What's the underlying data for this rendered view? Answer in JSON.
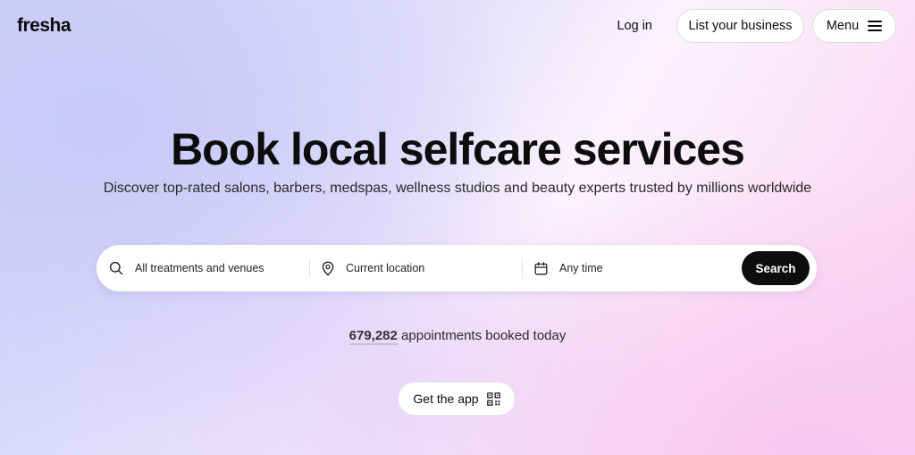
{
  "header": {
    "logo": "fresha",
    "login_label": "Log in",
    "list_business_label": "List your business",
    "menu_label": "Menu"
  },
  "hero": {
    "title": "Book local selfcare services",
    "subtitle": "Discover top-rated salons, barbers, medspas, wellness studios and beauty experts trusted by millions worldwide"
  },
  "search": {
    "treatments_placeholder": "All treatments and venues",
    "location_placeholder": "Current location",
    "time_placeholder": "Any time",
    "button_label": "Search"
  },
  "stats": {
    "count": "679,282",
    "suffix": " appointments booked today"
  },
  "get_app": {
    "label": "Get the app"
  },
  "icons": {
    "search": "search-icon",
    "location": "location-pin-icon",
    "calendar": "calendar-icon",
    "menu": "hamburger-icon",
    "qr": "qr-code-icon"
  },
  "colors": {
    "primary_button": "#0d0d0d",
    "background_left": "#cfd0fa",
    "background_right": "#f7cdef"
  }
}
